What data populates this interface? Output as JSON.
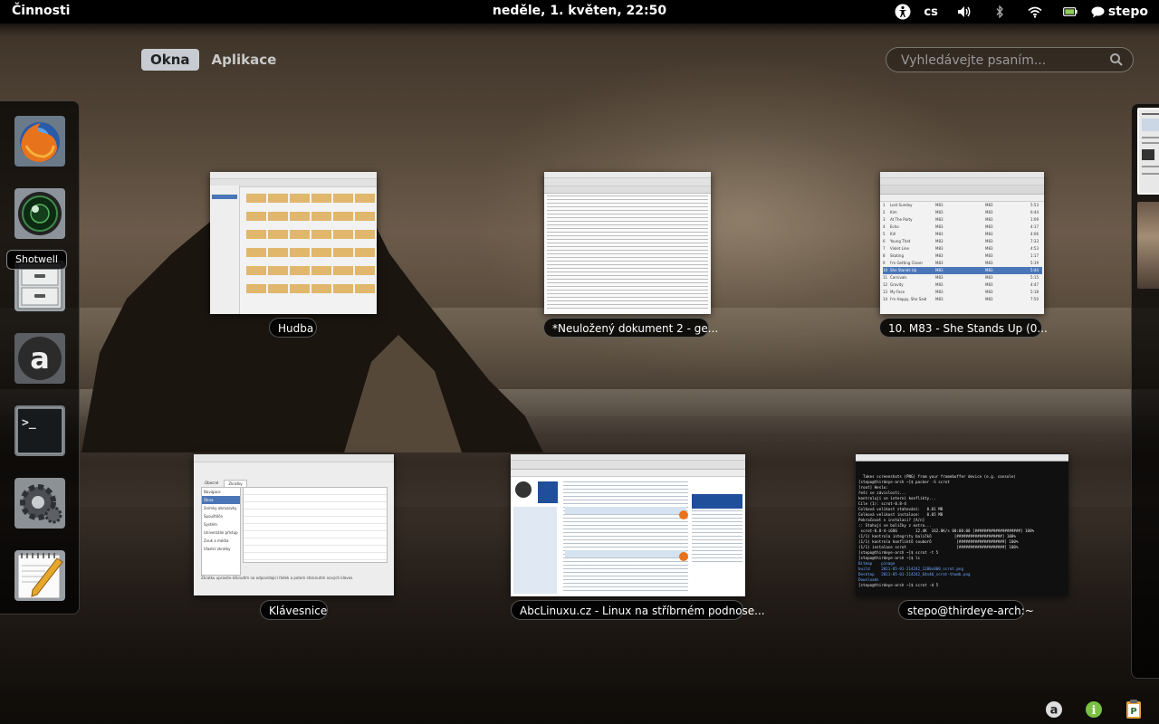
{
  "top_panel": {
    "activities": "Činnosti",
    "clock": "neděle,  1. květen, 22:50",
    "language": "cs",
    "user": "stepo"
  },
  "overview": {
    "tabs": [
      {
        "label": "Okna",
        "active": true
      },
      {
        "label": "Aplikace",
        "active": false
      }
    ],
    "search_placeholder": "Vyhledávejte psaním..."
  },
  "dash": {
    "items": [
      {
        "name": "firefox-icon"
      },
      {
        "name": "shotwell-icon"
      },
      {
        "name": "file-cabinet-icon"
      },
      {
        "name": "amazon-icon"
      },
      {
        "name": "terminal-icon"
      },
      {
        "name": "settings-gear-icon"
      },
      {
        "name": "text-editor-icon"
      }
    ],
    "tooltip": "Shotwell"
  },
  "windows": [
    {
      "title": "Hudba",
      "kind": "file-manager"
    },
    {
      "title": "*Neuložený dokument 2 - ge...",
      "kind": "text-editor"
    },
    {
      "title": "10. M83 - She Stands Up (0...",
      "kind": "music-player"
    },
    {
      "title": "Klávesnice",
      "kind": "keyboard-settings"
    },
    {
      "title": "AbcLinuxu.cz - Linux na stříbrném podnose...",
      "kind": "browser"
    },
    {
      "title": "stepo@thirdeye-arch:~",
      "kind": "terminal"
    }
  ],
  "terminal_lines": [
    "  Takes screenshots (PNG) from your framebuffer device (e.g. console)",
    "[stepo@thirdeye-arch ~]$ packer -S scrot",
    "[root] Heslo:",
    "řeší se závislosti...",
    "kontrolují se interní konflikty...",
    "",
    "Cíle (1): scrot-0.8-4",
    "",
    "Celková velikost stahování:   0.01 MB",
    "Celková velikost instalace:   0.05 MB",
    "",
    "Pokračovat v instalaci? [A/n]",
    ":: Stahují se balíčky z extra...",
    " scrot-0.8-4-i686        12.4K  162.0K/s 00:00:00 [####################] 100%",
    "(1/1) kontrola integrity balíčků          [####################] 100%",
    "(1/1) kontrola konfliktů souborů           [####################] 100%",
    "(1/1) instalace scrot                      [####################] 100%",
    "[stepo@thirdeye-arch ~]$ scrot -t 5",
    "[stepo@thirdeye-arch ~]$ ls",
    "Bitmap    pinage",
    "build     2011-05-01-214242_1280x800_scrot.png",
    "Desktop   2011-05-01-214242_64x40_scrot-thumb.png",
    "Downloads",
    "[stepo@thirdeye-arch ~]$ scrot -d 5"
  ],
  "playlist": [
    {
      "n": "1",
      "title": "Lost Sunday",
      "artist": "M83",
      "album": "M83",
      "time": "5:53"
    },
    {
      "n": "2",
      "title": "Kim",
      "artist": "M83",
      "album": "M83",
      "time": "6:44"
    },
    {
      "n": "3",
      "title": "At The Party",
      "artist": "M83",
      "album": "M83",
      "time": "1:09"
    },
    {
      "n": "4",
      "title": "Echo",
      "artist": "M83",
      "album": "M83",
      "time": "4:17"
    },
    {
      "n": "5",
      "title": "Kill",
      "artist": "M83",
      "album": "M83",
      "time": "4:06"
    },
    {
      "n": "6",
      "title": "Young That",
      "artist": "M83",
      "album": "M83",
      "time": "7:33"
    },
    {
      "n": "7",
      "title": "Violet Line",
      "artist": "M83",
      "album": "M83",
      "time": "4:53"
    },
    {
      "n": "8",
      "title": "Skating",
      "artist": "M83",
      "album": "M83",
      "time": "1:17"
    },
    {
      "n": "9",
      "title": "I'm Getting Closer",
      "artist": "M83",
      "album": "M83",
      "time": "5:19"
    },
    {
      "n": "10",
      "title": "She Stands Up",
      "artist": "M83",
      "album": "M83",
      "time": "5:44"
    },
    {
      "n": "11",
      "title": "Carnivals",
      "artist": "M83",
      "album": "M83",
      "time": "5:15"
    },
    {
      "n": "12",
      "title": "Gravity",
      "artist": "M83",
      "album": "M83",
      "time": "4:47"
    },
    {
      "n": "13",
      "title": "My Face",
      "artist": "M83",
      "album": "M83",
      "time": "5:18"
    },
    {
      "n": "14",
      "title": "I'm Happy, She Said",
      "artist": "M83",
      "album": "M83",
      "time": "7:50"
    }
  ],
  "keyboard_settings": {
    "tabs": [
      "Obecné",
      "Zkratky"
    ],
    "categories": [
      "Navigace",
      "Okna",
      "Snímky obrazovky",
      "Spouštěče",
      "Systém",
      "Univerzální přístup",
      "Zvuk a média",
      "Vlastní zkratky"
    ],
    "hint": "Zkratku upravíte kliknutím na odpovídající řádek a potom stisknutím nových kláves."
  },
  "colors": {
    "panel": "#000000",
    "tab_active": "#c7ccd2",
    "selection_blue": "#4a76b8"
  }
}
